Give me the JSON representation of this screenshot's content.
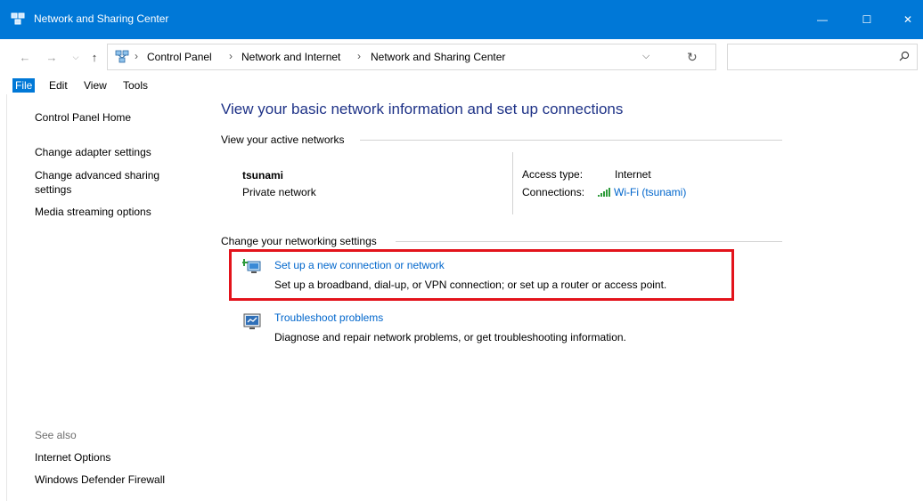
{
  "window": {
    "title": "Network and Sharing Center",
    "minimize_glyph": "—",
    "maximize_glyph": "☐",
    "close_glyph": "✕"
  },
  "nav": {
    "back_glyph": "←",
    "forward_glyph": "→",
    "recent_glyph": "⌵",
    "up_glyph": "↑"
  },
  "address": {
    "breadcrumbs": [
      "Control Panel",
      "Network and Internet",
      "Network and Sharing Center"
    ],
    "separator": "›",
    "dropdown_glyph": "⌵",
    "refresh_glyph": "↻"
  },
  "search": {
    "placeholder": ""
  },
  "menu": [
    "File",
    "Edit",
    "View",
    "Tools"
  ],
  "sidebar": {
    "links": [
      "Control Panel Home",
      "Change adapter settings",
      "Change advanced sharing settings",
      "Media streaming options"
    ],
    "see_also_label": "See also",
    "see_also_links": [
      "Internet Options",
      "Windows Defender Firewall"
    ]
  },
  "main": {
    "title": "View your basic network information and set up connections",
    "active_networks_heading": "View your active networks",
    "network": {
      "name": "tsunami",
      "type": "Private network",
      "access_type_label": "Access type:",
      "access_type_value": "Internet",
      "connections_label": "Connections:",
      "connections_value": "Wi-Fi (tsunami)"
    },
    "settings_heading": "Change your networking settings",
    "tasks": [
      {
        "icon": "new-connection-icon",
        "title": "Set up a new connection or network",
        "description": "Set up a broadband, dial-up, or VPN connection; or set up a router or access point."
      },
      {
        "icon": "troubleshoot-icon",
        "title": "Troubleshoot problems",
        "description": "Diagnose and repair network problems, or get troubleshooting information."
      }
    ]
  },
  "colors": {
    "titlebar": "#0078d7",
    "link": "#0066cc",
    "heading": "#1e3287",
    "highlight": "#e3131b"
  }
}
